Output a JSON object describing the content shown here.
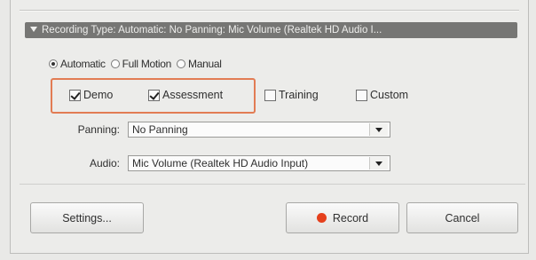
{
  "recording_bar": {
    "text": "Recording Type: Automatic: No Panning: Mic Volume (Realtek HD Audio I..."
  },
  "mode": {
    "options": [
      {
        "label": "Automatic",
        "selected": true
      },
      {
        "label": "Full Motion",
        "selected": false
      },
      {
        "label": "Manual",
        "selected": false
      }
    ]
  },
  "types": [
    {
      "label": "Demo",
      "checked": true
    },
    {
      "label": "Assessment",
      "checked": true
    },
    {
      "label": "Training",
      "checked": false
    },
    {
      "label": "Custom",
      "checked": false
    }
  ],
  "panning": {
    "label": "Panning:",
    "value": "No Panning"
  },
  "audio": {
    "label": "Audio:",
    "value": "Mic Volume (Realtek HD Audio Input)"
  },
  "buttons": {
    "settings": "Settings...",
    "record": "Record",
    "cancel": "Cancel"
  },
  "colors": {
    "highlight": "#e27c54",
    "record_dot": "#e5401c"
  }
}
